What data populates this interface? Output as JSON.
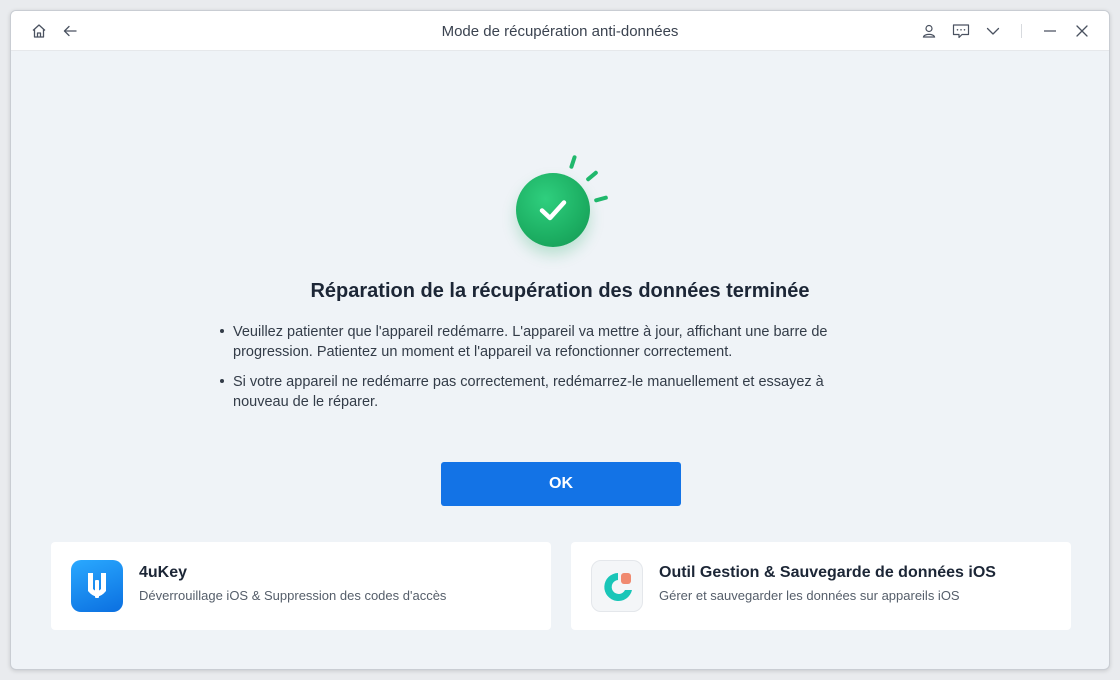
{
  "window": {
    "title": "Mode de récupération anti-données"
  },
  "titlebar_icons": {
    "left": [
      "home-icon",
      "back-arrow-icon"
    ],
    "right": [
      "user-icon",
      "feedback-icon",
      "chevron-down-icon",
      "minimize-icon",
      "close-icon"
    ]
  },
  "main": {
    "heading": "Réparation de la récupération des données terminée",
    "bullets": [
      "Veuillez patienter que l'appareil redémarre. L'appareil va mettre à jour, affichant une barre de progression. Patientez un moment et l'appareil va refonctionner correctement.",
      "Si votre appareil ne redémarre pas correctement, redémarrez-le manuellement et essayez à nouveau de le réparer."
    ],
    "ok_label": "OK"
  },
  "cards": [
    {
      "title": "4uKey",
      "description": "Déverrouillage iOS & Suppression des codes d'accès",
      "icon": "4ukey-app-icon"
    },
    {
      "title": "Outil Gestion & Sauvegarde de données iOS",
      "description": "Gérer et sauvegarder les données sur appareils iOS",
      "icon": "icarefone-app-icon"
    }
  ],
  "colors": {
    "accent": "#1373e6",
    "success": "#1cae62",
    "background": "#eff3f7"
  }
}
